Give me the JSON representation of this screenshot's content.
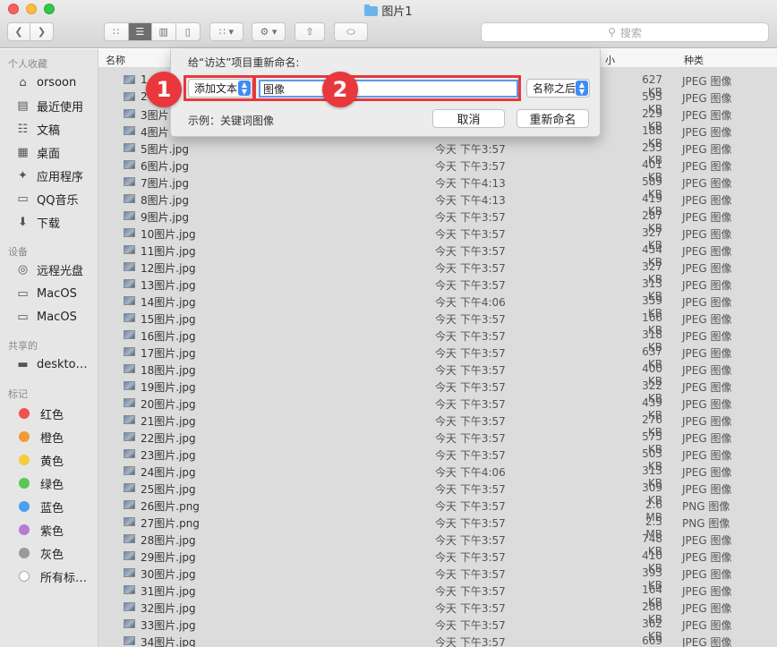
{
  "window": {
    "title": "图片1"
  },
  "toolbar": {
    "search_placeholder": "搜索"
  },
  "sidebar": {
    "favorites_header": "个人收藏",
    "favorites": [
      {
        "label": "orsoon",
        "icon": "home-icon"
      },
      {
        "label": "最近使用",
        "icon": "recents-icon"
      },
      {
        "label": "文稿",
        "icon": "documents-icon"
      },
      {
        "label": "桌面",
        "icon": "desktop-icon"
      },
      {
        "label": "应用程序",
        "icon": "applications-icon"
      },
      {
        "label": "QQ音乐",
        "icon": "folder-icon"
      },
      {
        "label": "下载",
        "icon": "downloads-icon"
      }
    ],
    "devices_header": "设备",
    "devices": [
      {
        "label": "远程光盘",
        "icon": "disc-icon"
      },
      {
        "label": "MacOS",
        "icon": "disk-icon"
      },
      {
        "label": "MacOS",
        "icon": "disk-icon"
      }
    ],
    "shared_header": "共享的",
    "shared": [
      {
        "label": "deskto…",
        "icon": "display-icon"
      }
    ],
    "tags_header": "标记",
    "tags": [
      {
        "label": "红色",
        "color": "#f2524f"
      },
      {
        "label": "橙色",
        "color": "#f39a36"
      },
      {
        "label": "黄色",
        "color": "#f5cd3a"
      },
      {
        "label": "绿色",
        "color": "#5cc554"
      },
      {
        "label": "蓝色",
        "color": "#4a9ef2"
      },
      {
        "label": "紫色",
        "color": "#b77bd4"
      },
      {
        "label": "灰色",
        "color": "#9a9a9a"
      },
      {
        "label": "所有标…",
        "color": "#ffffff"
      }
    ]
  },
  "columns": {
    "name": "名称",
    "size": "小",
    "kind": "种类"
  },
  "files": [
    {
      "name": "1",
      "date": "",
      "size": "627 KB",
      "kind": "JPEG 图像"
    },
    {
      "name": "2",
      "date": "",
      "size": "593 KB",
      "kind": "JPEG 图像"
    },
    {
      "name": "3图片",
      "date": "",
      "size": "229 KB",
      "kind": "JPEG 图像"
    },
    {
      "name": "4图片",
      "date": "",
      "size": "188 KB",
      "kind": "JPEG 图像"
    },
    {
      "name": "5图片.jpg",
      "date": "今天 下午3:57",
      "size": "235 KB",
      "kind": "JPEG 图像"
    },
    {
      "name": "6图片.jpg",
      "date": "今天 下午3:57",
      "size": "401 KB",
      "kind": "JPEG 图像"
    },
    {
      "name": "7图片.jpg",
      "date": "今天 下午4:13",
      "size": "589 KB",
      "kind": "JPEG 图像"
    },
    {
      "name": "8图片.jpg",
      "date": "今天 下午4:13",
      "size": "419 KB",
      "kind": "JPEG 图像"
    },
    {
      "name": "9图片.jpg",
      "date": "今天 下午3:57",
      "size": "287 KB",
      "kind": "JPEG 图像"
    },
    {
      "name": "10图片.jpg",
      "date": "今天 下午3:57",
      "size": "327 KB",
      "kind": "JPEG 图像"
    },
    {
      "name": "11图片.jpg",
      "date": "今天 下午3:57",
      "size": "454 KB",
      "kind": "JPEG 图像"
    },
    {
      "name": "12图片.jpg",
      "date": "今天 下午3:57",
      "size": "327 KB",
      "kind": "JPEG 图像"
    },
    {
      "name": "13图片.jpg",
      "date": "今天 下午3:57",
      "size": "313 KB",
      "kind": "JPEG 图像"
    },
    {
      "name": "14图片.jpg",
      "date": "今天 下午4:06",
      "size": "359 KB",
      "kind": "JPEG 图像"
    },
    {
      "name": "15图片.jpg",
      "date": "今天 下午3:57",
      "size": "166 KB",
      "kind": "JPEG 图像"
    },
    {
      "name": "16图片.jpg",
      "date": "今天 下午3:57",
      "size": "318 KB",
      "kind": "JPEG 图像"
    },
    {
      "name": "17图片.jpg",
      "date": "今天 下午3:57",
      "size": "637 KB",
      "kind": "JPEG 图像"
    },
    {
      "name": "18图片.jpg",
      "date": "今天 下午3:57",
      "size": "400 KB",
      "kind": "JPEG 图像"
    },
    {
      "name": "19图片.jpg",
      "date": "今天 下午3:57",
      "size": "322 KB",
      "kind": "JPEG 图像"
    },
    {
      "name": "20图片.jpg",
      "date": "今天 下午3:57",
      "size": "439 KB",
      "kind": "JPEG 图像"
    },
    {
      "name": "21图片.jpg",
      "date": "今天 下午3:57",
      "size": "276 KB",
      "kind": "JPEG 图像"
    },
    {
      "name": "22图片.jpg",
      "date": "今天 下午3:57",
      "size": "575 KB",
      "kind": "JPEG 图像"
    },
    {
      "name": "23图片.jpg",
      "date": "今天 下午3:57",
      "size": "503 KB",
      "kind": "JPEG 图像"
    },
    {
      "name": "24图片.jpg",
      "date": "今天 下午4:06",
      "size": "313 KB",
      "kind": "JPEG 图像"
    },
    {
      "name": "25图片.jpg",
      "date": "今天 下午3:57",
      "size": "309 KB",
      "kind": "JPEG 图像"
    },
    {
      "name": "26图片.png",
      "date": "今天 下午3:57",
      "size": "2.6 MB",
      "kind": "PNG 图像"
    },
    {
      "name": "27图片.png",
      "date": "今天 下午3:57",
      "size": "2.5 MB",
      "kind": "PNG 图像"
    },
    {
      "name": "28图片.jpg",
      "date": "今天 下午3:57",
      "size": "748 KB",
      "kind": "JPEG 图像"
    },
    {
      "name": "29图片.jpg",
      "date": "今天 下午3:57",
      "size": "410 KB",
      "kind": "JPEG 图像"
    },
    {
      "name": "30图片.jpg",
      "date": "今天 下午3:57",
      "size": "393 KB",
      "kind": "JPEG 图像"
    },
    {
      "name": "31图片.jpg",
      "date": "今天 下午3:57",
      "size": "164 KB",
      "kind": "JPEG 图像"
    },
    {
      "name": "32图片.jpg",
      "date": "今天 下午3:57",
      "size": "286 KB",
      "kind": "JPEG 图像"
    },
    {
      "name": "33图片.jpg",
      "date": "今天 下午3:57",
      "size": "362 KB",
      "kind": "JPEG 图像"
    },
    {
      "name": "34图片.jpg",
      "date": "今天 下午3:57",
      "size": "669 KB",
      "kind": "JPEG 图像"
    }
  ],
  "rename_sheet": {
    "title": "给“访达”项目重新命名:",
    "mode": "添加文本",
    "text_value": "图像",
    "position": "名称之后",
    "example": "示例：关键词图像",
    "cancel_label": "取消",
    "rename_label": "重新命名"
  },
  "annotations": {
    "badge1": "1",
    "badge2": "2"
  }
}
